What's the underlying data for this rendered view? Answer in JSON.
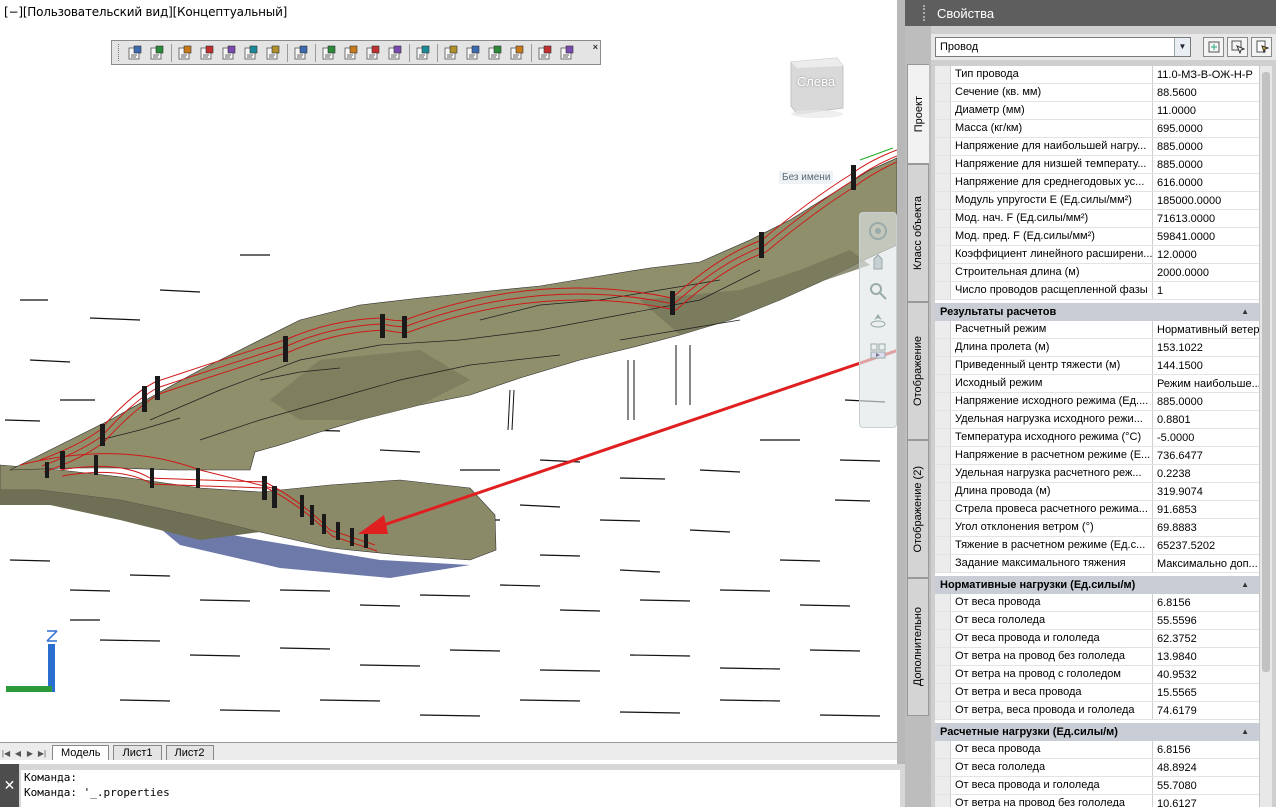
{
  "viewport": {
    "view_label": "[−][Пользовательский вид][Концептуальный]",
    "viewcube_label": "Слева",
    "unnamed_label": "Без имени",
    "axis_z": "Z"
  },
  "toolbar": {
    "icons": [
      "properties-list-icon",
      "layers-icon",
      "edit-line-icon",
      "edit-poles-icon",
      "pole-add-icon",
      "edit-wire-icon",
      "transfer-icon",
      "help-query-icon",
      "report-icon",
      "table-icon",
      "calc-icon",
      "3d-view-icon",
      "print-icon",
      "om-icon",
      "export-icon",
      "chart-icon",
      "sag-chart-icon",
      "cube-icon",
      "settings-icon"
    ],
    "close_label": "×"
  },
  "layout_tabs": {
    "tabs": [
      "Модель",
      "Лист1",
      "Лист2"
    ],
    "active": "Модель"
  },
  "command_line": {
    "close_label": "✕",
    "lines": [
      "Команда:",
      "Команда: '_.properties"
    ]
  },
  "palette": {
    "title": "Свойства",
    "selected_type": "Провод",
    "side_tabs": [
      "Проект",
      "Класс объекта",
      "Отображение",
      "Отображение (2)",
      "Дополнительно"
    ],
    "active_side_tab": "Проект",
    "groups": [
      {
        "title": "",
        "rows": [
          {
            "name": "Тип провода",
            "value": "11.0-МЗ-В-ОЖ-Н-Р"
          },
          {
            "name": "Сечение (кв. мм)",
            "value": "88.5600"
          },
          {
            "name": "Диаметр (мм)",
            "value": "11.0000"
          },
          {
            "name": "Масса (кг/км)",
            "value": "695.0000"
          },
          {
            "name": "Напряжение для наибольшей нагру...",
            "value": "885.0000"
          },
          {
            "name": "Напряжение для низшей температу...",
            "value": "885.0000"
          },
          {
            "name": "Напряжение для среднегодовых ус...",
            "value": "616.0000"
          },
          {
            "name": "Модуль упругости E (Ед.силы/мм²)",
            "value": "185000.0000"
          },
          {
            "name": "Мод. нач. F (Ед.силы/мм²)",
            "value": "71613.0000"
          },
          {
            "name": "Мод. пред. F (Ед.силы/мм²)",
            "value": "59841.0000"
          },
          {
            "name": "Коэффициент линейного расширени...",
            "value": "12.0000"
          },
          {
            "name": "Строительная длина (м)",
            "value": "2000.0000"
          },
          {
            "name": "Число проводов расщепленной фазы",
            "value": "1"
          }
        ]
      },
      {
        "title": "Результаты расчетов",
        "rows": [
          {
            "name": "Расчетный режим",
            "value": "Нормативный ветер"
          },
          {
            "name": "Длина пролета (м)",
            "value": "153.1022"
          },
          {
            "name": "Приведенный центр тяжести (м)",
            "value": "144.1500"
          },
          {
            "name": "Исходный режим",
            "value": "Режим наибольше..."
          },
          {
            "name": "Напряжение исходного режима (Ед....",
            "value": "885.0000"
          },
          {
            "name": "Удельная нагрузка исходного режи...",
            "value": "0.8801"
          },
          {
            "name": "Температура исходного режима (°C)",
            "value": "-5.0000"
          },
          {
            "name": "Напряжение в расчетном режиме (Е...",
            "value": "736.6477"
          },
          {
            "name": "Удельная нагрузка расчетного реж...",
            "value": "0.2238"
          },
          {
            "name": "Длина провода (м)",
            "value": "319.9074"
          },
          {
            "name": "Стрела провеса расчетного режима...",
            "value": "91.6853"
          },
          {
            "name": "Угол отклонения ветром (°)",
            "value": "69.8883"
          },
          {
            "name": "Тяжение в расчетном режиме (Ед.с...",
            "value": "65237.5202"
          },
          {
            "name": "Задание максимального тяжения",
            "value": "Максимально доп..."
          }
        ]
      },
      {
        "title": "Нормативные нагрузки (Ед.силы/м)",
        "rows": [
          {
            "name": "От веса провода",
            "value": "6.8156"
          },
          {
            "name": "От веса гололеда",
            "value": "55.5596"
          },
          {
            "name": "От веса провода и гололеда",
            "value": "62.3752"
          },
          {
            "name": "От ветра на провод без гололеда",
            "value": "13.9840"
          },
          {
            "name": "От ветра на провод с гололедом",
            "value": "40.9532"
          },
          {
            "name": "От ветра и веса провода",
            "value": "15.5565"
          },
          {
            "name": "От ветра, веса провода и гололеда",
            "value": "74.6179"
          }
        ]
      },
      {
        "title": "Расчетные нагрузки (Ед.силы/м)",
        "rows": [
          {
            "name": "От веса провода",
            "value": "6.8156"
          },
          {
            "name": "От веса гололеда",
            "value": "48.8924"
          },
          {
            "name": "От веса провода и гололеда",
            "value": "55.7080"
          },
          {
            "name": "От ветра на провод без гололеда",
            "value": "10.6127"
          }
        ]
      }
    ]
  },
  "colors": {
    "terrain": "#8a8a68",
    "terrain_dark": "#6f6f55",
    "water": "#5c6aa0",
    "wire": "#d01818",
    "annotation_arrow": "#e02020",
    "palette_header": "#5e5e5e",
    "group_header": "#c9ced6"
  }
}
